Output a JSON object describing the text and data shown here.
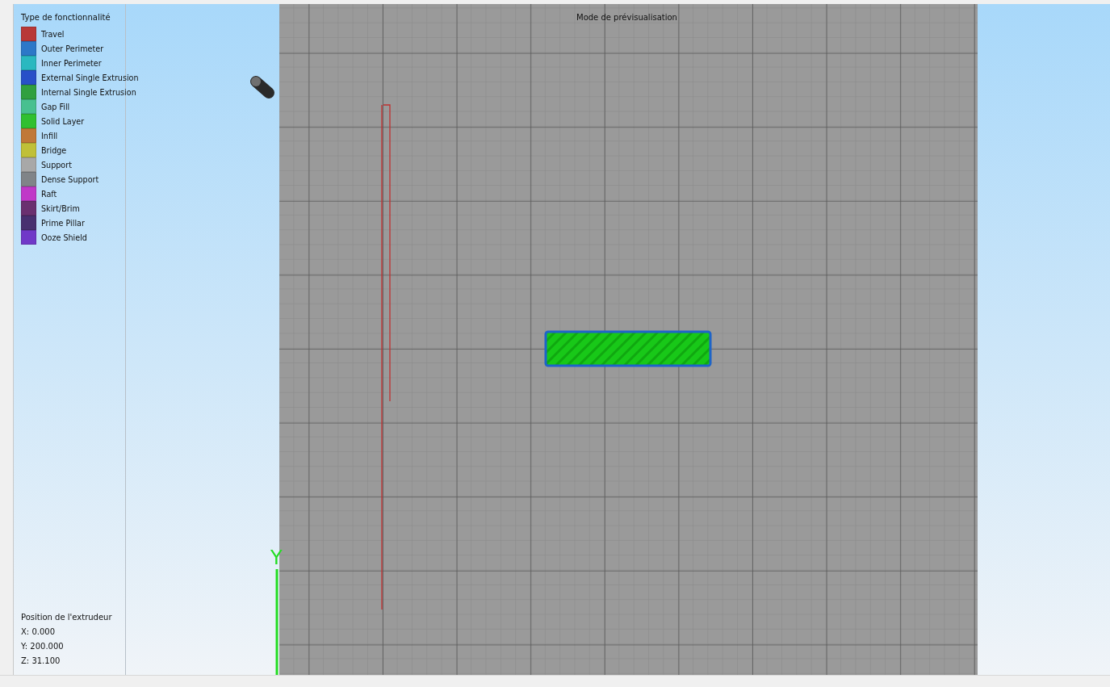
{
  "viewport": {
    "title": "Mode de prévisualisation",
    "axis_label": "Y"
  },
  "legend": {
    "title": "Type de fonctionnalité",
    "items": [
      {
        "label": "Travel",
        "color": "#b83838"
      },
      {
        "label": "Outer Perimeter",
        "color": "#2c78c8"
      },
      {
        "label": "Inner Perimeter",
        "color": "#2ab8c0"
      },
      {
        "label": "External Single Extrusion",
        "color": "#2850c8"
      },
      {
        "label": "Internal Single Extrusion",
        "color": "#30a040"
      },
      {
        "label": "Gap Fill",
        "color": "#48c090"
      },
      {
        "label": "Solid Layer",
        "color": "#30c030"
      },
      {
        "label": "Infill",
        "color": "#c07838"
      },
      {
        "label": "Bridge",
        "color": "#c0c038"
      },
      {
        "label": "Support",
        "color": "#a8a8a8"
      },
      {
        "label": "Dense Support",
        "color": "#808488"
      },
      {
        "label": "Raft",
        "color": "#c038c8"
      },
      {
        "label": "Skirt/Brim",
        "color": "#6a3070"
      },
      {
        "label": "Prime Pillar",
        "color": "#483070"
      },
      {
        "label": "Ooze Shield",
        "color": "#7038c8"
      }
    ]
  },
  "extruder_position": {
    "title": "Position de l'extrudeur",
    "lines": [
      "X: 0.000",
      "Y: 200.000",
      "Z: 31.100"
    ]
  }
}
